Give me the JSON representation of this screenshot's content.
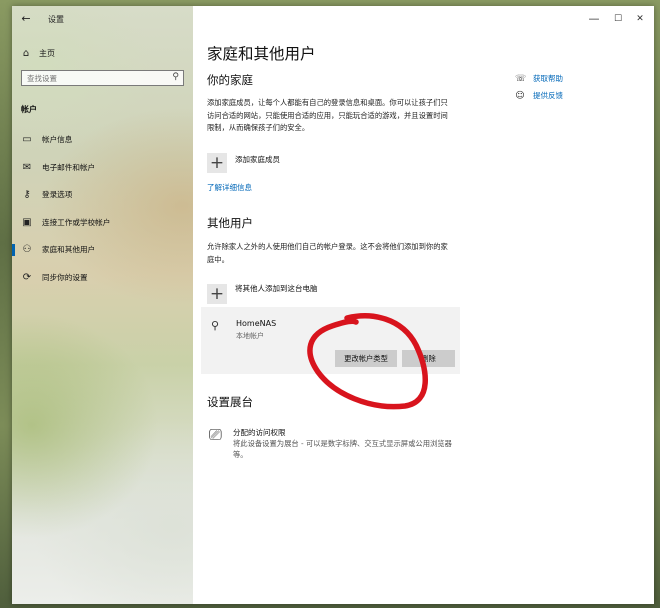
{
  "window": {
    "title": "设置",
    "back_icon": "back-arrow-icon",
    "controls": [
      "—",
      "☐",
      "✕"
    ]
  },
  "sidebar": {
    "home": {
      "label": "主页",
      "icon": "home-icon"
    },
    "search": {
      "placeholder": "查找设置",
      "icon": "search-icon"
    },
    "section": "帐户",
    "items": [
      {
        "label": "帐户信息",
        "icon": "person-card-icon",
        "active": false
      },
      {
        "label": "电子邮件和帐户",
        "icon": "mail-icon",
        "active": false
      },
      {
        "label": "登录选项",
        "icon": "key-icon",
        "active": false
      },
      {
        "label": "连接工作或学校帐户",
        "icon": "briefcase-icon",
        "active": false
      },
      {
        "label": "家庭和其他用户",
        "icon": "people-icon",
        "active": true
      },
      {
        "label": "同步你的设置",
        "icon": "sync-icon",
        "active": false
      }
    ]
  },
  "main": {
    "title": "家庭和其他用户",
    "family": {
      "heading": "你的家庭",
      "description": "添加家庭成员，让每个人都能有自己的登录信息和桌面。你可以让孩子们只访问合适的网站，只能使用合适的应用，只能玩合适的游戏，并且设置时间限制，从而确保孩子们的安全。",
      "add_label": "添加家庭成员",
      "learn_more": "了解详细信息"
    },
    "other_users": {
      "heading": "其他用户",
      "description": "允许除家人之外的人使用他们自己的帐户登录。这不会将他们添加到你的家庭中。",
      "add_label": "将其他人添加到这台电脑",
      "account": {
        "name": "HomeNAS",
        "type": "本地帐户",
        "change_button": "更改帐户类型",
        "remove_button": "删除"
      }
    },
    "kiosk": {
      "heading": "设置展台",
      "title": "分配的访问权限",
      "description": "将此设备设置为展台 - 可以是数字标牌、交互式显示屏或公用浏览器等。"
    }
  },
  "help": {
    "get_help": "获取帮助",
    "feedback": "提供反馈"
  },
  "annotation": {
    "color": "#d8141d",
    "shape": "hand-drawn circle around 更改帐户类型 button"
  }
}
